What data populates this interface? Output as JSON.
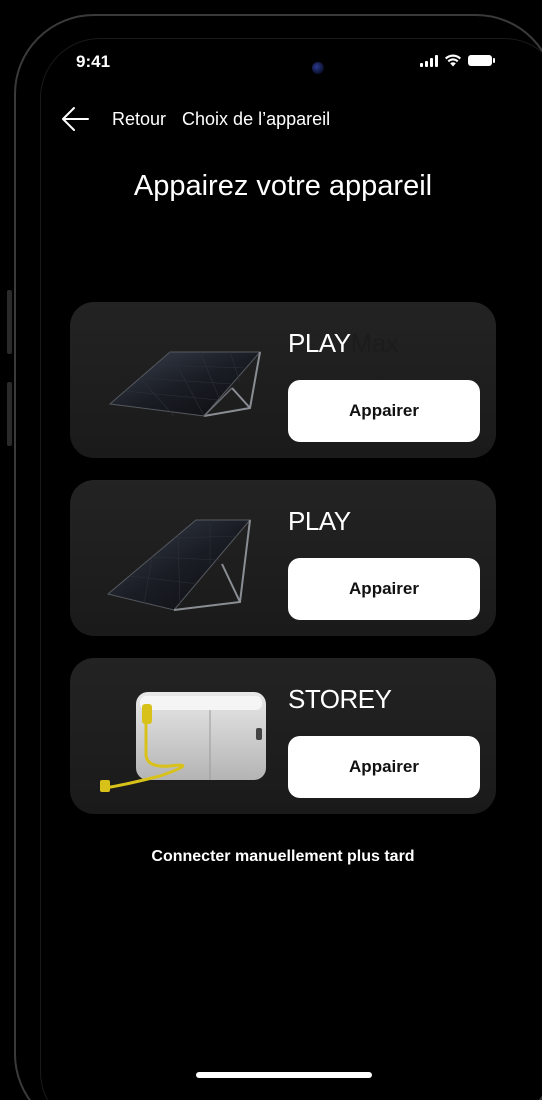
{
  "status_bar": {
    "time": "9:41"
  },
  "header": {
    "back_label": "Retour",
    "title": "Choix de l’appareil"
  },
  "page_title": "Appairez votre appareil",
  "devices": [
    {
      "name": "PLAY",
      "suffix": "Max",
      "button": "Appairer",
      "image": "solar-panel"
    },
    {
      "name": "PLAY",
      "suffix": "",
      "button": "Appairer",
      "image": "solar-panel"
    },
    {
      "name": "STOREY",
      "suffix": "",
      "button": "Appairer",
      "image": "battery-storage"
    }
  ],
  "manual_link": "Connecter manuellement plus tard",
  "colors": {
    "background": "#000000",
    "card": "#1e1e1e",
    "button": "#ffffff",
    "accent_cable": "#d8c21a"
  }
}
